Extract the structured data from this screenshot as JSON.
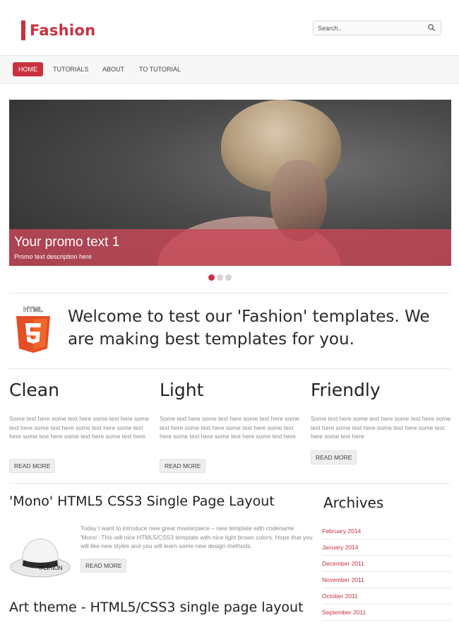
{
  "header": {
    "logo_text": "Fashion",
    "search_placeholder": "Search.."
  },
  "nav": {
    "items": [
      {
        "label": "HOME",
        "active": true
      },
      {
        "label": "TUTORIALS",
        "active": false
      },
      {
        "label": "ABOUT",
        "active": false
      },
      {
        "label": "TO TUTORIAL",
        "active": false
      }
    ]
  },
  "slider": {
    "promo_title": "Your promo text 1",
    "promo_description": "Promo text description here",
    "slide_count": 3,
    "active_slide": 1
  },
  "welcome": {
    "badge_text": "HTML",
    "text": "Welcome to test our 'Fashion' templates. We are making best templates for you."
  },
  "features": [
    {
      "title": "Clean",
      "text": "Some text here some text here some text here some text here some text here some text here some text here some text here some text here some text here",
      "button": "READ MORE"
    },
    {
      "title": "Light",
      "text": "Some text here some text here some text here some text here some text here some text here some text here some text here some text here some text here",
      "button": "READ MORE"
    },
    {
      "title": "Friendly",
      "text": "Some text here some text here some text here some text here some text here some text here some text here some text here",
      "button": "READ MORE"
    }
  ],
  "post": {
    "title": "'Mono' HTML5 CSS3 Single Page Layout",
    "text": "Today I want to introduce new great masterpiece – new template with codename 'Mono'. This will nice HTML5/CSS3 template with nice light brown colors. Hope that you will like new styles and you will learn some new design methods.",
    "button": "READ MORE",
    "image_label": "fASHION"
  },
  "post2": {
    "title": "Art theme - HTML5/CSS3 single page layout"
  },
  "archives": {
    "title": "Archives",
    "items": [
      "February 2014",
      "January 2014",
      "December 2011",
      "November 2011",
      "October 2011",
      "September 2011"
    ]
  },
  "colors": {
    "accent": "#c9313f",
    "promo_overlay": "#c84858"
  }
}
